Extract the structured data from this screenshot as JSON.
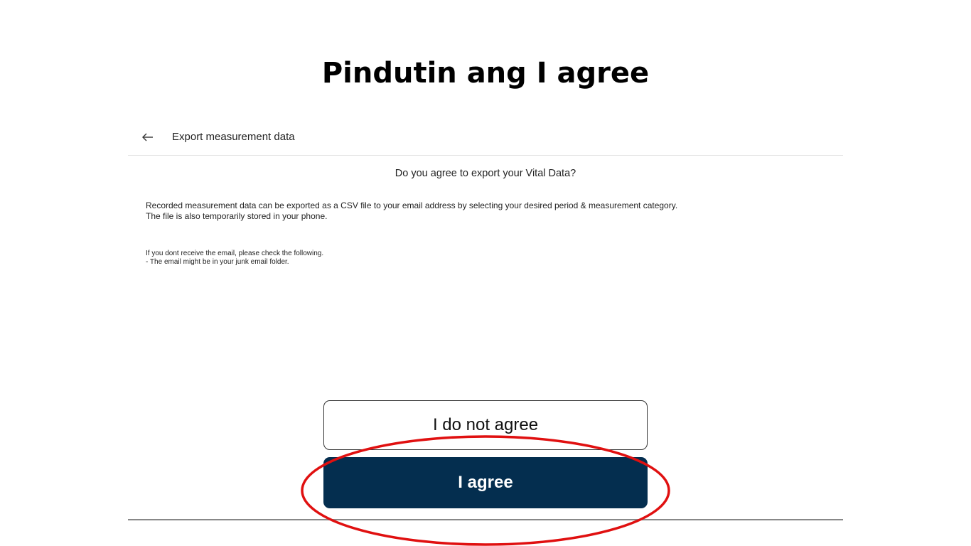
{
  "instruction": {
    "title": "Pindutin ang I agree"
  },
  "header": {
    "back_icon": "arrow-left-icon",
    "title": "Export measurement data"
  },
  "content": {
    "question": "Do you agree to export your Vital Data?",
    "description_line1": "Recorded measurement data can be exported as a CSV file to your email address by selecting your desired period & measurement category.",
    "description_line2": "The file is also temporarily stored in your phone.",
    "note_line1": "If you dont receive the email, please check the following.",
    "note_line2": "- The email might be in your junk email folder."
  },
  "buttons": {
    "disagree_label": "I do not agree",
    "agree_label": "I agree"
  },
  "colors": {
    "agree_button": "#042e4f",
    "highlight_circle": "#e01010"
  }
}
